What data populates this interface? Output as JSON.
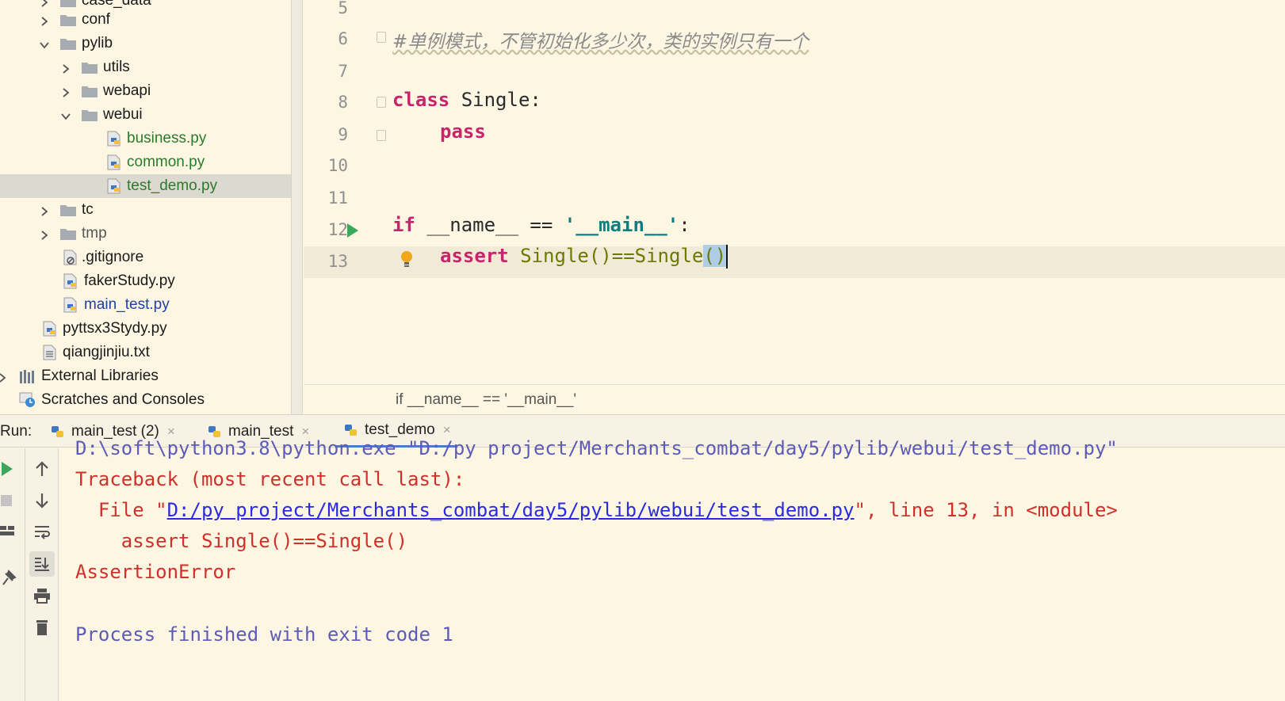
{
  "tree": {
    "items": [
      {
        "label": "case_data",
        "kind": "folder"
      },
      {
        "label": "conf",
        "kind": "folder"
      },
      {
        "label": "pylib",
        "kind": "folder"
      },
      {
        "label": "utils",
        "kind": "folder"
      },
      {
        "label": "webapi",
        "kind": "folder"
      },
      {
        "label": "webui",
        "kind": "folder"
      },
      {
        "label": "business.py",
        "kind": "python-file"
      },
      {
        "label": "common.py",
        "kind": "python-file"
      },
      {
        "label": "test_demo.py",
        "kind": "python-file"
      },
      {
        "label": "tc",
        "kind": "folder"
      },
      {
        "label": "tmp",
        "kind": "folder"
      },
      {
        "label": ".gitignore",
        "kind": "ignore-file"
      },
      {
        "label": "fakerStudy.py",
        "kind": "python-file"
      },
      {
        "label": "main_test.py",
        "kind": "python-file"
      },
      {
        "label": "pyttsx3Stydy.py",
        "kind": "python-file"
      },
      {
        "label": "qiangjinjiu.txt",
        "kind": "text-file"
      },
      {
        "label": "External Libraries",
        "kind": "libraries"
      },
      {
        "label": "Scratches and Consoles",
        "kind": "scratches"
      }
    ]
  },
  "editor": {
    "line_numbers": [
      "5",
      "6",
      "7",
      "8",
      "9",
      "10",
      "11",
      "12",
      "13"
    ],
    "comment": "#单例模式，不管初始化多少次，类的实例只有一个",
    "kw_class": "class",
    "class_name": " Single:",
    "kw_pass": "pass",
    "kw_if": "if",
    "if_mid": " __name__ == ",
    "main_str": "'__main__'",
    "colon": ":",
    "kw_assert": "assert",
    "assert_call1": " Single()==Single",
    "assert_paren": "()",
    "breadcrumb": "if __name__ == '__main__'"
  },
  "run": {
    "label": "Run:",
    "tabs": [
      {
        "label": "main_test (2)"
      },
      {
        "label": "main_test"
      },
      {
        "label": "test_demo"
      }
    ],
    "active_tab": "test_demo",
    "close_glyph": "×"
  },
  "console": {
    "cmd_line": "D:\\soft\\python3.8\\python.exe \"D:/py project/Merchants_combat/day5/pylib/webui/test_demo.py\"",
    "traceback": "Traceback (most recent call last):",
    "file_prefix": "  File \"",
    "file_link": "D:/py project/Merchants_combat/day5/pylib/webui/test_demo.py",
    "file_suffix": "\", line 13, in <module>",
    "assert_line": "    assert Single()==Single()",
    "error": "AssertionError",
    "finished": "Process finished with exit code 1"
  },
  "colors": {
    "background": "#fdf6e3",
    "keyword": "#c8246b",
    "string": "#0a7f7f",
    "error": "#d0302a",
    "command": "#5c5cb8",
    "link": "#2a2ae0",
    "selection": "#b0cde8"
  }
}
